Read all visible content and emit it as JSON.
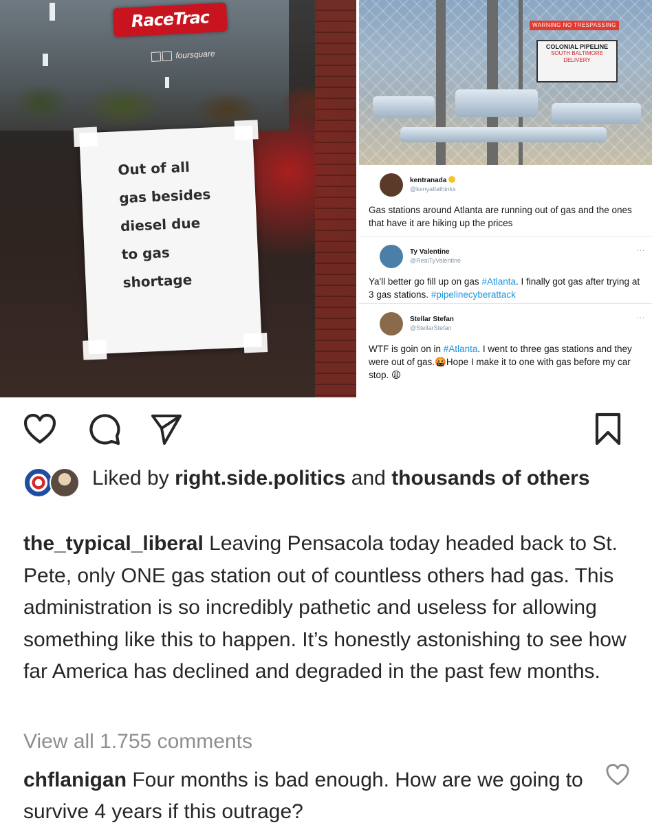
{
  "media": {
    "left_photo": {
      "store_sign": "RaceTrac",
      "social_sticker": "foursquare",
      "sign_lines": [
        "Out of all",
        "gas besides",
        "diesel due",
        "to gas",
        "shortage"
      ]
    },
    "right_photo": {
      "warning_sign": "WARNING NO TRESPASSING",
      "pipeline_sign_title": "COLONIAL PIPELINE",
      "pipeline_sign_sub": "SOUTH BALTIMORE",
      "pipeline_sign_sub2": "DELIVERY"
    },
    "tweets": [
      {
        "name": "kentranada",
        "handle": "@kenyattathinks",
        "text": "Gas stations around Atlanta are running out of gas and the ones that have it are hiking up the prices",
        "avatar_color": "#5a3b2a"
      },
      {
        "name": "Ty Valentine",
        "handle": "@RealTyValentine",
        "more": "...",
        "text_pre": "Ya'll better go fill up on gas ",
        "tag1": "#Atlanta",
        "text_mid": ". I finally got gas after trying at 3 gas stations. ",
        "tag2": "#pipelinecyberattack",
        "avatar_color": "#4a7fa7"
      },
      {
        "name": "Stellar Stefan",
        "handle": "@StellarStefan",
        "more": "...",
        "text_pre": "WTF is goin on in ",
        "tag1": "#Atlanta",
        "text_mid": ". I went to three gas stations and they were out of gas.",
        "emoji1": "🤬",
        "text_mid2": "Hope I make it to one with gas before my car stop. ",
        "emoji2": "😩",
        "avatar_color": "#8a6a4a"
      }
    ]
  },
  "actions": {
    "like_icon": "heart-outline-icon",
    "comment_icon": "comment-bubble-icon",
    "share_icon": "paper-plane-icon",
    "save_icon": "bookmark-icon"
  },
  "likes": {
    "prefix": "Liked by ",
    "user": "right.side.politics",
    "middle": " and ",
    "rest": "thousands of others"
  },
  "caption": {
    "username": "the_typical_liberal",
    "text": " Leaving Pensacola today headed back to St. Pete, only ONE gas station out of countless others had gas. This administration is so incredibly pathetic and useless for allowing something like this to happen. It’s honestly astonishing to see how far America has declined and degraded in the past few months."
  },
  "view_all_comments": "View all 1.755 comments",
  "comment": {
    "username": "chflanigan",
    "text": " Four months is bad enough. How are we going to survive 4 years if this outrage?"
  },
  "colors": {
    "text": "#262626",
    "secondary": "#8e8e8e",
    "link": "#1b95e0"
  }
}
